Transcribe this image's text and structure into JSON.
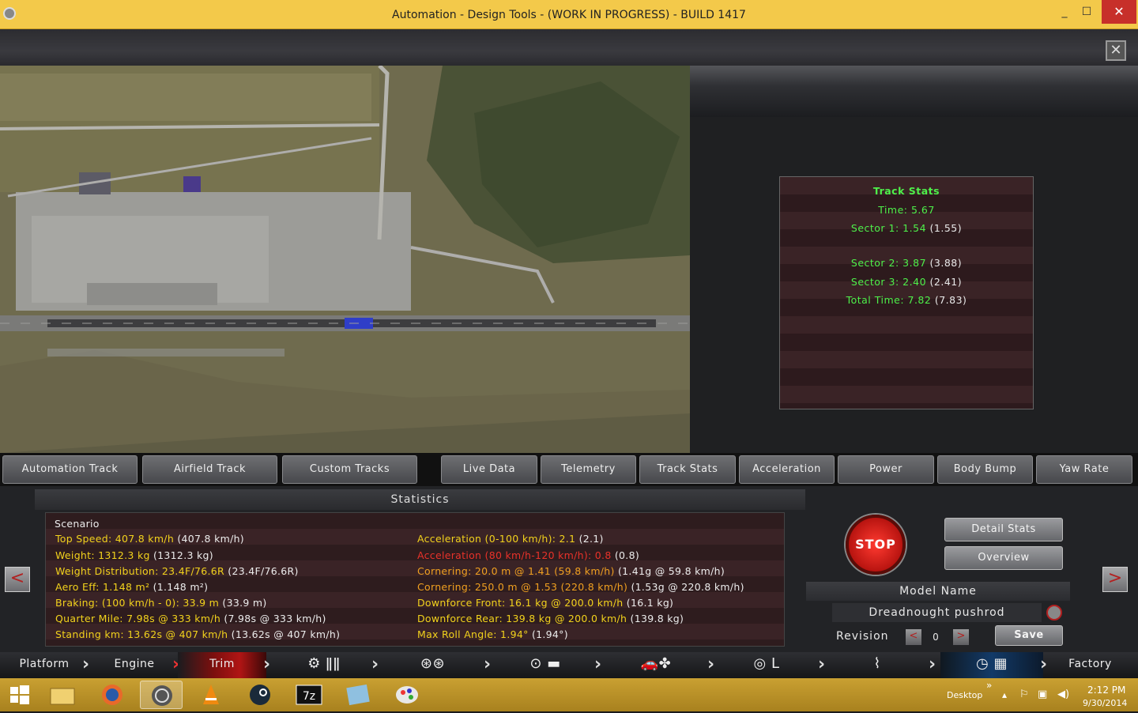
{
  "window": {
    "title": "Automation - Design Tools - (WORK IN PROGRESS) - BUILD 1417",
    "min": "_",
    "max": "☐",
    "close": "✕"
  },
  "game_close": "✕",
  "track_stats": {
    "title": "Track Stats",
    "time": "Time: 5.67",
    "sector1": "Sector 1: 1.54",
    "sector1_ref": "(1.55)",
    "sector2": "Sector 2: 3.87",
    "sector2_ref": "(3.88)",
    "sector3": "Sector 3: 2.40",
    "sector3_ref": "(2.41)",
    "total": "Total Time: 7.82",
    "total_ref": "(7.83)"
  },
  "track_tabs": [
    "Automation Track",
    "Airfield Track",
    "Custom Tracks"
  ],
  "data_tabs": [
    "Live Data",
    "Telemetry",
    "Track Stats",
    "Acceleration",
    "Power",
    "Body Bump",
    "Yaw Rate"
  ],
  "statistics": {
    "title": "Statistics",
    "scenario": "Scenario",
    "left": [
      {
        "label": "Top Speed: 407.8 km/h",
        "ref": "(407.8 km/h)"
      },
      {
        "label": "Weight: 1312.3 kg",
        "ref": "(1312.3 kg)"
      },
      {
        "label": "Weight Distribution: 23.4F/76.6R",
        "ref": "(23.4F/76.6R)"
      },
      {
        "label": "Aero Eff: 1.148 m²",
        "ref": "(1.148 m²)"
      },
      {
        "label": "Braking: (100 km/h - 0): 33.9 m",
        "ref": "(33.9 m)"
      },
      {
        "label": "Quarter Mile: 7.98s @ 333 km/h",
        "ref": "(7.98s @ 333 km/h)"
      },
      {
        "label": "Standing km: 13.62s @ 407 km/h",
        "ref": "(13.62s @ 407 km/h)"
      }
    ],
    "right": [
      {
        "label": "Acceleration (0-100 km/h): 2.1",
        "ref": "(2.1)"
      },
      {
        "label": "Acceleration (80 km/h-120 km/h): 0.8",
        "ref": "(0.8)"
      },
      {
        "label": "Cornering: 20.0 m @ 1.41 (59.8 km/h)",
        "ref": "(1.41g @ 59.8 km/h)"
      },
      {
        "label": "Cornering: 250.0 m @ 1.53 (220.8 km/h)",
        "ref": "(1.53g @ 220.8 km/h)"
      },
      {
        "label": "Downforce Front: 16.1 kg @ 200.0 km/h",
        "ref": "(16.1 kg)"
      },
      {
        "label": "Downforce Rear: 139.8 kg @ 200.0 km/h",
        "ref": "(139.8 kg)"
      },
      {
        "label": "Max Roll Angle: 1.94°",
        "ref": "(1.94°)"
      }
    ]
  },
  "controls": {
    "stop": "STOP",
    "detail_stats": "Detail Stats",
    "overview": "Overview",
    "model_name_label": "Model Name",
    "model_name": "Dreadnought pushrod",
    "revision_label": "Revision",
    "revision": "0",
    "save": "Save",
    "prev": "<",
    "next": ">"
  },
  "nav": {
    "platform": "Platform",
    "engine": "Engine",
    "trim": "Trim",
    "factory": "Factory"
  },
  "taskbar": {
    "desktop": "Desktop",
    "time": "2:12 PM",
    "date": "9/30/2014",
    "overflow": "»"
  },
  "colors": {
    "titlebar": "#f3c94a",
    "stat_yellow": "#f2d21c",
    "stat_red": "#e8322a",
    "track_green": "#4ef04a"
  }
}
